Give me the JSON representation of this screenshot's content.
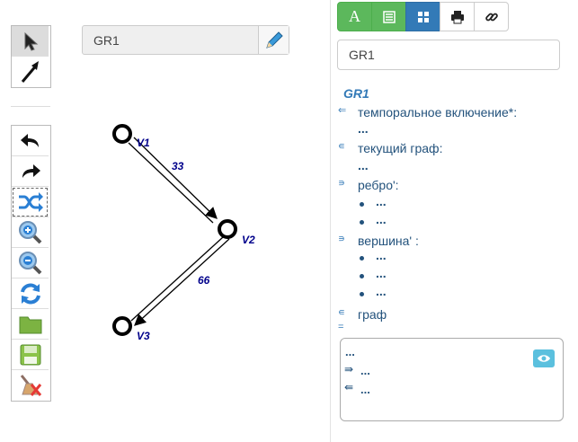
{
  "graph_name_field": {
    "value": "GR1"
  },
  "graph": {
    "vertices": [
      {
        "label": "V1"
      },
      {
        "label": "V2"
      },
      {
        "label": "V3"
      }
    ],
    "edges": [
      {
        "from": "V1",
        "to": "V2",
        "weight": "33"
      },
      {
        "from": "V2",
        "to": "V3",
        "weight": "66"
      }
    ]
  },
  "right_panel": {
    "tabs": [
      {
        "label": "A"
      },
      {
        "icon": "list-icon"
      },
      {
        "icon": "grid-icon"
      },
      {
        "icon": "print-icon"
      },
      {
        "icon": "link-icon"
      }
    ],
    "title_input": {
      "value": "GR1"
    },
    "tree": {
      "title": "GR1",
      "rows": [
        {
          "symbol": "⇐",
          "label": "темпоральное включение*:"
        },
        {
          "value": "..."
        },
        {
          "symbol": "∊",
          "label": "текущий граф:"
        },
        {
          "value": "..."
        },
        {
          "symbol": "∍",
          "label": "ребро':"
        },
        {
          "value": "..."
        },
        {
          "value": "..."
        },
        {
          "symbol": "∍",
          "label": "вершина' :"
        },
        {
          "value": "..."
        },
        {
          "value": "..."
        },
        {
          "value": "..."
        },
        {
          "symbol": "∊",
          "label": "граф"
        },
        {
          "symbol": "="
        }
      ]
    },
    "textarea": {
      "lines": [
        {
          "symbol": "",
          "value": "..."
        },
        {
          "symbol": "⇛",
          "value": "..."
        },
        {
          "symbol": "⇚",
          "value": "..."
        }
      ]
    }
  },
  "colors": {
    "vertex": "#000000",
    "label": "#00008b",
    "link": "#337ab7",
    "green": "#5cb85c",
    "blue": "#337ab7"
  }
}
